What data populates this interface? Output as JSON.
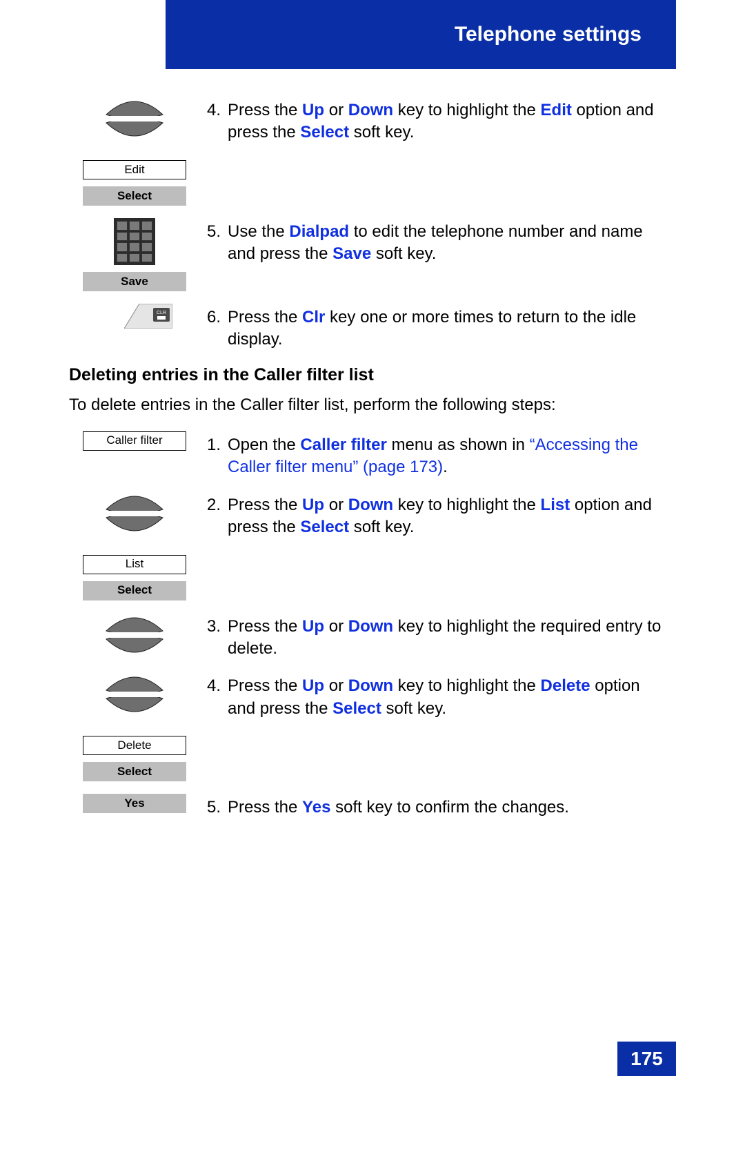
{
  "header": {
    "title": "Telephone settings"
  },
  "footer": {
    "page_number": "175"
  },
  "section1_steps": {
    "step4": {
      "num": "4.",
      "t1": "Press the ",
      "k_up": "Up",
      "t2": " or ",
      "k_down": "Down",
      "t3": " key to highlight the ",
      "k_edit": "Edit",
      "t4": " option and press the ",
      "k_select": "Select",
      "t5": " soft key.",
      "box_edit": "Edit",
      "box_select": "Select"
    },
    "step5": {
      "num": "5.",
      "t1": "Use the ",
      "k_dialpad": "Dialpad",
      "t2": " to edit the telephone number and name and press the ",
      "k_save": "Save",
      "t3": " soft key.",
      "box_save": "Save"
    },
    "step6": {
      "num": "6.",
      "t1": "Press the ",
      "k_clr": "Clr",
      "t2": " key one or more times to return to the idle display."
    }
  },
  "section2": {
    "title": "Deleting entries in the Caller filter list",
    "intro": "To delete entries in the Caller filter list, perform the following steps:",
    "steps": {
      "step1": {
        "num": "1.",
        "t1": "Open the ",
        "k_cf": "Caller filter",
        "t2": " menu as shown in ",
        "link": "“Accessing the Caller filter menu” (page 173)",
        "t3": ".",
        "box_cf": "Caller filter"
      },
      "step2": {
        "num": "2.",
        "t1": "Press the ",
        "k_up": "Up",
        "t2": " or ",
        "k_down": "Down",
        "t3": " key to highlight the ",
        "k_list": "List",
        "t4": " option and press the ",
        "k_select": "Select",
        "t5": " soft key.",
        "box_list": "List",
        "box_select": "Select"
      },
      "step3": {
        "num": "3.",
        "t1": "Press the ",
        "k_up": "Up",
        "t2": " or ",
        "k_down": "Down",
        "t3": " key to highlight the required entry to delete."
      },
      "step4": {
        "num": "4.",
        "t1": "Press the ",
        "k_up": "Up",
        "t2": " or ",
        "k_down": "Down",
        "t3": " key to highlight the ",
        "k_delete": "Delete",
        "t4": " option and press the ",
        "k_select": "Select",
        "t5": " soft key.",
        "box_delete": "Delete",
        "box_select": "Select"
      },
      "step5": {
        "num": "5.",
        "t1": "Press the ",
        "k_yes": "Yes",
        "t2": " soft key to confirm the changes.",
        "box_yes": "Yes"
      }
    }
  }
}
